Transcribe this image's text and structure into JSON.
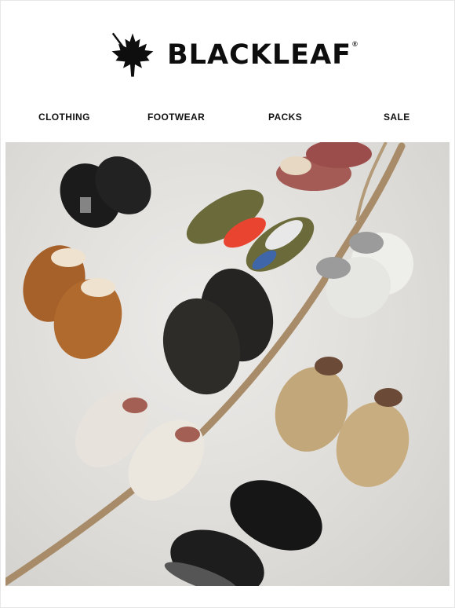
{
  "brand": {
    "name": "BLACKLEAF",
    "registered_mark": "®",
    "logo_icon": "maple-leaf-icon"
  },
  "nav": {
    "items": [
      {
        "label": "CLOTHING"
      },
      {
        "label": "FOOTWEAR"
      },
      {
        "label": "PACKS"
      },
      {
        "label": "SALE"
      }
    ]
  },
  "hero": {
    "image": "footwear-collection-photo"
  },
  "colors": {
    "text": "#111111",
    "background": "#ffffff",
    "hero_bg": "#dedcd8"
  }
}
